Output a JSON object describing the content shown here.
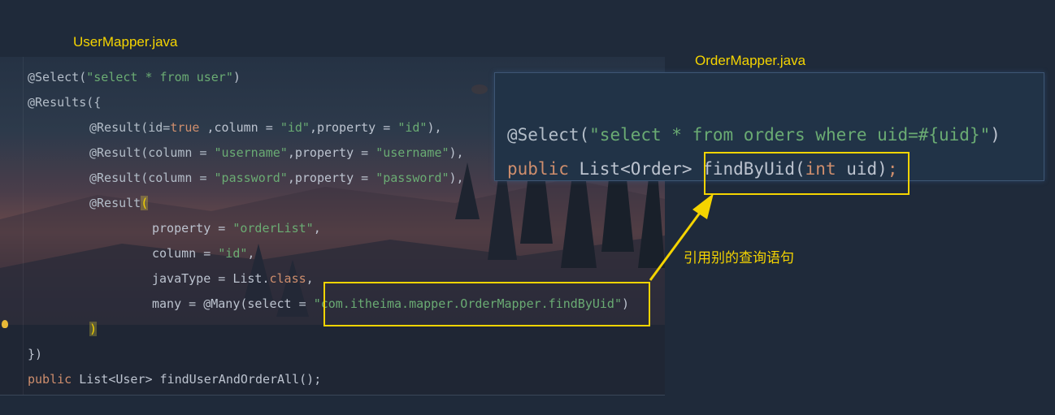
{
  "labels": {
    "user_file": "UserMapper.java",
    "order_file": "OrderMapper.java",
    "annotation": "引用别的查询语句"
  },
  "user_code": {
    "l1_ann": "@Select(",
    "l1_str": "\"select * from user\"",
    "l1_end": ")",
    "l2": "@Results({",
    "l3_a": "@Result(id=",
    "l3_kw": "true",
    "l3_b": " ,column = ",
    "l3_s1": "\"id\"",
    "l3_c": ",property = ",
    "l3_s2": "\"id\"",
    "l3_d": "),",
    "l4_a": "@Result(column = ",
    "l4_s1": "\"username\"",
    "l4_c": ",property = ",
    "l4_s2": "\"username\"",
    "l4_d": "),",
    "l5_a": "@Result(column = ",
    "l5_s1": "\"password\"",
    "l5_c": ",property = ",
    "l5_s2": "\"password\"",
    "l5_d": "),",
    "l6_a": "@Result",
    "l6_brace": "(",
    "l7_a": "property = ",
    "l7_s": "\"orderList\"",
    "l7_b": ",",
    "l8_a": "column = ",
    "l8_s": "\"id\"",
    "l8_b": ",",
    "l9_a": "javaType = List.",
    "l9_kw": "class",
    "l9_b": ",",
    "l10_a": "many = @Many(select = ",
    "l10_s": "\"com.itheima.mapper.OrderMapper.findByUid\"",
    "l10_b": ")",
    "l11_brace": ")",
    "l12": "})",
    "l13_kw": "public",
    "l13_rest": " List<User> findUserAndOrderAll();"
  },
  "order_code": {
    "l1_ann": "@Select(",
    "l1_str": "\"select * from orders where uid=#{uid}\"",
    "l1_end": ")",
    "l2_kw": "public",
    "l2_a": " List<Order> findByUid(",
    "l2_kw2": "int",
    "l2_b": " uid)",
    "l2_semi": ";"
  },
  "colors": {
    "highlight": "#f5d400",
    "string": "#6aab73",
    "keyword": "#cf8e6d"
  }
}
